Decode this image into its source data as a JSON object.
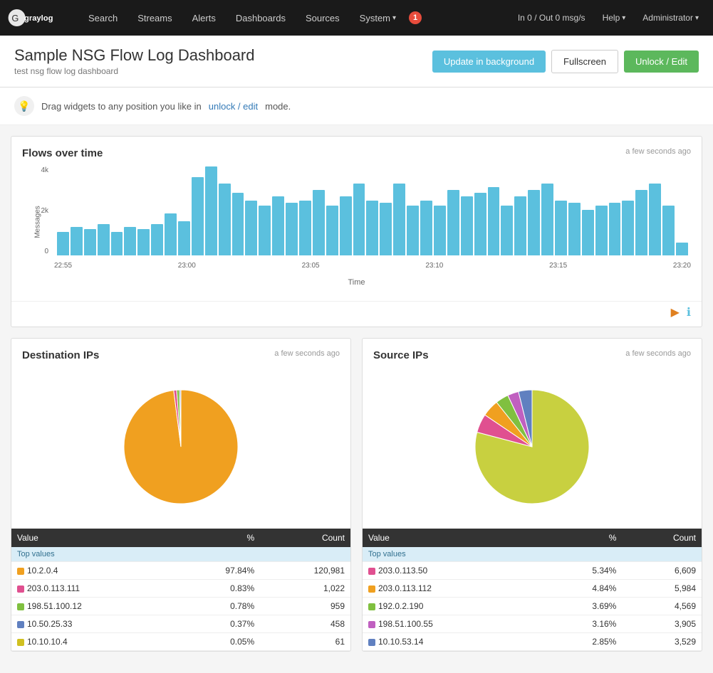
{
  "navbar": {
    "logo_text": "graylog",
    "items": [
      {
        "label": "Search",
        "id": "search"
      },
      {
        "label": "Streams",
        "id": "streams"
      },
      {
        "label": "Alerts",
        "id": "alerts"
      },
      {
        "label": "Dashboards",
        "id": "dashboards"
      },
      {
        "label": "Sources",
        "id": "sources"
      },
      {
        "label": "System",
        "id": "system",
        "has_dropdown": true
      }
    ],
    "notification_count": "1",
    "throughput": "In 0 / Out 0 msg/s",
    "help": "Help",
    "admin": "Administrator"
  },
  "dashboard": {
    "title": "Sample NSG Flow Log Dashboard",
    "subtitle": "test nsg flow log dashboard",
    "btn_update": "Update in background",
    "btn_fullscreen": "Fullscreen",
    "btn_unlock": "Unlock / Edit",
    "info_text": "Drag widgets to any position you like in",
    "info_link": "unlock / edit",
    "info_suffix": "mode."
  },
  "flows_chart": {
    "title": "Flows over time",
    "timestamp": "a few seconds ago",
    "x_label": "Time",
    "y_labels": [
      "4k",
      "2k",
      "0"
    ],
    "x_ticks": [
      "22:55",
      "23:00",
      "23:05",
      "23:10",
      "23:15",
      "23:20"
    ],
    "bars": [
      18,
      22,
      20,
      24,
      18,
      22,
      20,
      24,
      32,
      26,
      60,
      68,
      55,
      48,
      42,
      38,
      45,
      40,
      42,
      50,
      38,
      45,
      55,
      42,
      40,
      55,
      38,
      42,
      38,
      50,
      45,
      48,
      52,
      38,
      45,
      50,
      55,
      42,
      40,
      35,
      38,
      40,
      42,
      50,
      55,
      38,
      10
    ]
  },
  "destination_ips": {
    "title": "Destination IPs",
    "timestamp": "a few seconds ago",
    "table_headers": [
      "Value",
      "%",
      "Count"
    ],
    "section_label": "Top values",
    "rows": [
      {
        "color": "#f0a020",
        "ip": "10.2.0.4",
        "pct": "97.84%",
        "count": "120,981"
      },
      {
        "color": "#e05090",
        "ip": "203.0.113.111",
        "pct": "0.83%",
        "count": "1,022"
      },
      {
        "color": "#80c040",
        "ip": "198.51.100.12",
        "pct": "0.78%",
        "count": "959"
      },
      {
        "color": "#6080c0",
        "ip": "10.50.25.33",
        "pct": "0.37%",
        "count": "458"
      },
      {
        "color": "#d0c020",
        "ip": "10.10.10.4",
        "pct": "0.05%",
        "count": "61"
      }
    ],
    "pie_slices": [
      {
        "color": "#f0a020",
        "pct": 97.84
      },
      {
        "color": "#e05090",
        "pct": 0.83
      },
      {
        "color": "#80c040",
        "pct": 0.78
      },
      {
        "color": "#6080c0",
        "pct": 0.37
      },
      {
        "color": "#d0c020",
        "pct": 0.05
      }
    ]
  },
  "source_ips": {
    "title": "Source IPs",
    "timestamp": "a few seconds ago",
    "table_headers": [
      "Value",
      "%",
      "Count"
    ],
    "section_label": "Top values",
    "rows": [
      {
        "color": "#e05090",
        "ip": "203.0.113.50",
        "pct": "5.34%",
        "count": "6,609"
      },
      {
        "color": "#f0a020",
        "ip": "203.0.113.112",
        "pct": "4.84%",
        "count": "5,984"
      },
      {
        "color": "#80c040",
        "ip": "192.0.2.190",
        "pct": "3.69%",
        "count": "4,569"
      },
      {
        "color": "#c060c0",
        "ip": "198.51.100.55",
        "pct": "3.16%",
        "count": "3,905"
      },
      {
        "color": "#6080c0",
        "ip": "10.10.53.14",
        "pct": "2.85%",
        "count": "3,529"
      }
    ],
    "pie_slices": [
      {
        "color": "#c8d040",
        "pct": 79.12
      },
      {
        "color": "#e05090",
        "pct": 5.34
      },
      {
        "color": "#f0a020",
        "pct": 4.84
      },
      {
        "color": "#80c040",
        "pct": 3.69
      },
      {
        "color": "#c060c0",
        "pct": 3.16
      },
      {
        "color": "#6080c0",
        "pct": 3.85
      }
    ]
  }
}
